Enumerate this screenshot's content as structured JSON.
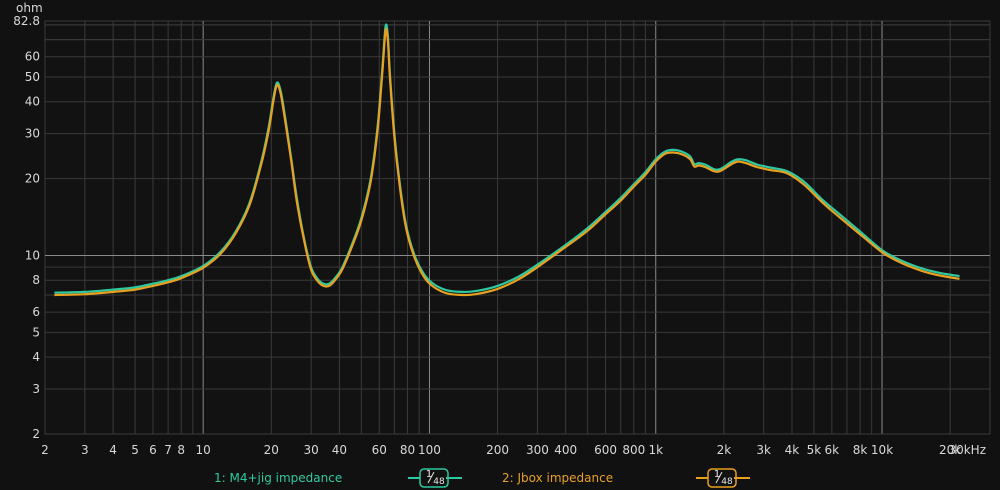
{
  "chart_data": {
    "type": "line",
    "ylabel": "ohm",
    "x_scale": "log",
    "y_scale": "log",
    "xlim": [
      2,
      30000
    ],
    "ylim": [
      2,
      82.8
    ],
    "x_ticks": [
      {
        "v": 2,
        "label": "2"
      },
      {
        "v": 3,
        "label": "3"
      },
      {
        "v": 4,
        "label": "4"
      },
      {
        "v": 5,
        "label": "5"
      },
      {
        "v": 6,
        "label": "6"
      },
      {
        "v": 7,
        "label": "7"
      },
      {
        "v": 8,
        "label": "8"
      },
      {
        "v": 10,
        "label": "10"
      },
      {
        "v": 20,
        "label": "20"
      },
      {
        "v": 30,
        "label": "30"
      },
      {
        "v": 40,
        "label": "40"
      },
      {
        "v": 60,
        "label": "60"
      },
      {
        "v": 80,
        "label": "80"
      },
      {
        "v": 100,
        "label": "100"
      },
      {
        "v": 200,
        "label": "200"
      },
      {
        "v": 300,
        "label": "300"
      },
      {
        "v": 400,
        "label": "400"
      },
      {
        "v": 600,
        "label": "600"
      },
      {
        "v": 800,
        "label": "800"
      },
      {
        "v": 1000,
        "label": "1k"
      },
      {
        "v": 2000,
        "label": "2k"
      },
      {
        "v": 3000,
        "label": "3k"
      },
      {
        "v": 4000,
        "label": "4k"
      },
      {
        "v": 5000,
        "label": "5k"
      },
      {
        "v": 6000,
        "label": "6k"
      },
      {
        "v": 8000,
        "label": "8k"
      },
      {
        "v": 10000,
        "label": "10k"
      },
      {
        "v": 20000,
        "label": "20k"
      },
      {
        "v": 30000,
        "label": "30kHz"
      }
    ],
    "y_ticks": [
      {
        "v": 2,
        "label": "2"
      },
      {
        "v": 3,
        "label": "3"
      },
      {
        "v": 4,
        "label": "4"
      },
      {
        "v": 5,
        "label": "5"
      },
      {
        "v": 6,
        "label": "6"
      },
      {
        "v": 8,
        "label": "8"
      },
      {
        "v": 10,
        "label": "10"
      },
      {
        "v": 20,
        "label": "20"
      },
      {
        "v": 30,
        "label": "30"
      },
      {
        "v": 40,
        "label": "40"
      },
      {
        "v": 50,
        "label": "50"
      },
      {
        "v": 60,
        "label": "60"
      },
      {
        "v": 82.8,
        "label": "82.8"
      }
    ],
    "grid": true,
    "legend_position": "bottom",
    "series": [
      {
        "name": "1: M4+jig impedance",
        "color": "#2ec9a0",
        "smoothing": "1/48",
        "points": [
          [
            2.2,
            7.15
          ],
          [
            3,
            7.2
          ],
          [
            4,
            7.35
          ],
          [
            5,
            7.5
          ],
          [
            6,
            7.75
          ],
          [
            7,
            8.0
          ],
          [
            8,
            8.3
          ],
          [
            10,
            9.1
          ],
          [
            12,
            10.4
          ],
          [
            14,
            12.5
          ],
          [
            16,
            16.0
          ],
          [
            18,
            23.0
          ],
          [
            19.5,
            32.0
          ],
          [
            20.5,
            42.0
          ],
          [
            21.2,
            47.5
          ],
          [
            22,
            44.0
          ],
          [
            23,
            35.0
          ],
          [
            24.5,
            24.0
          ],
          [
            26,
            16.5
          ],
          [
            28,
            11.5
          ],
          [
            30,
            9.0
          ],
          [
            32,
            8.1
          ],
          [
            34,
            7.75
          ],
          [
            36,
            7.75
          ],
          [
            38,
            8.1
          ],
          [
            41,
            8.9
          ],
          [
            45,
            10.8
          ],
          [
            50,
            14.0
          ],
          [
            55,
            20.0
          ],
          [
            59,
            32.0
          ],
          [
            62,
            55.0
          ],
          [
            64,
            79.0
          ],
          [
            65.5,
            72.0
          ],
          [
            67,
            50.0
          ],
          [
            70,
            30.0
          ],
          [
            74,
            19.0
          ],
          [
            79,
            13.0
          ],
          [
            86,
            10.0
          ],
          [
            95,
            8.4
          ],
          [
            105,
            7.7
          ],
          [
            120,
            7.3
          ],
          [
            140,
            7.2
          ],
          [
            160,
            7.25
          ],
          [
            200,
            7.6
          ],
          [
            250,
            8.3
          ],
          [
            300,
            9.2
          ],
          [
            400,
            11.0
          ],
          [
            500,
            12.8
          ],
          [
            600,
            14.8
          ],
          [
            700,
            16.8
          ],
          [
            800,
            19.0
          ],
          [
            900,
            21.2
          ],
          [
            1000,
            23.8
          ],
          [
            1100,
            25.5
          ],
          [
            1200,
            25.9
          ],
          [
            1320,
            25.4
          ],
          [
            1420,
            24.4
          ],
          [
            1480,
            22.8
          ],
          [
            1550,
            23.0
          ],
          [
            1650,
            22.7
          ],
          [
            1800,
            21.8
          ],
          [
            1900,
            21.7
          ],
          [
            2000,
            22.2
          ],
          [
            2150,
            23.2
          ],
          [
            2300,
            23.8
          ],
          [
            2500,
            23.6
          ],
          [
            2800,
            22.7
          ],
          [
            3200,
            22.1
          ],
          [
            3800,
            21.4
          ],
          [
            4500,
            19.5
          ],
          [
            5500,
            16.4
          ],
          [
            6500,
            14.5
          ],
          [
            8000,
            12.4
          ],
          [
            10000,
            10.5
          ],
          [
            12000,
            9.6
          ],
          [
            15000,
            8.9
          ],
          [
            18000,
            8.55
          ],
          [
            22000,
            8.3
          ]
        ]
      },
      {
        "name": "2: Jbox impedance",
        "color": "#e8a020",
        "smoothing": "1/48",
        "points": [
          [
            2.2,
            7.0
          ],
          [
            3,
            7.05
          ],
          [
            4,
            7.2
          ],
          [
            5,
            7.35
          ],
          [
            6,
            7.6
          ],
          [
            7,
            7.85
          ],
          [
            8,
            8.15
          ],
          [
            10,
            8.95
          ],
          [
            12,
            10.2
          ],
          [
            14,
            12.3
          ],
          [
            16,
            15.7
          ],
          [
            18,
            22.5
          ],
          [
            19.5,
            31.0
          ],
          [
            20.5,
            41.0
          ],
          [
            21.2,
            46.5
          ],
          [
            22,
            43.0
          ],
          [
            23,
            34.0
          ],
          [
            24.5,
            23.5
          ],
          [
            26,
            16.0
          ],
          [
            28,
            11.3
          ],
          [
            30,
            8.8
          ],
          [
            32,
            7.95
          ],
          [
            34,
            7.6
          ],
          [
            36,
            7.6
          ],
          [
            38,
            7.95
          ],
          [
            41,
            8.75
          ],
          [
            45,
            10.6
          ],
          [
            50,
            13.7
          ],
          [
            55,
            19.5
          ],
          [
            59,
            31.0
          ],
          [
            62,
            53.0
          ],
          [
            64,
            76.0
          ],
          [
            65.5,
            69.0
          ],
          [
            67,
            48.5
          ],
          [
            70,
            29.0
          ],
          [
            74,
            18.5
          ],
          [
            79,
            12.7
          ],
          [
            86,
            9.8
          ],
          [
            95,
            8.2
          ],
          [
            105,
            7.5
          ],
          [
            120,
            7.1
          ],
          [
            140,
            7.0
          ],
          [
            160,
            7.05
          ],
          [
            200,
            7.4
          ],
          [
            250,
            8.1
          ],
          [
            300,
            9.0
          ],
          [
            400,
            10.8
          ],
          [
            500,
            12.5
          ],
          [
            600,
            14.5
          ],
          [
            700,
            16.4
          ],
          [
            800,
            18.6
          ],
          [
            900,
            20.7
          ],
          [
            1000,
            23.3
          ],
          [
            1100,
            25.0
          ],
          [
            1200,
            25.3
          ],
          [
            1320,
            24.8
          ],
          [
            1420,
            23.8
          ],
          [
            1480,
            22.3
          ],
          [
            1550,
            22.5
          ],
          [
            1650,
            22.2
          ],
          [
            1800,
            21.4
          ],
          [
            1900,
            21.3
          ],
          [
            2000,
            21.8
          ],
          [
            2150,
            22.7
          ],
          [
            2300,
            23.3
          ],
          [
            2500,
            23.0
          ],
          [
            2800,
            22.2
          ],
          [
            3200,
            21.6
          ],
          [
            3800,
            21.0
          ],
          [
            4500,
            19.0
          ],
          [
            5500,
            16.0
          ],
          [
            6500,
            14.1
          ],
          [
            8000,
            12.1
          ],
          [
            10000,
            10.3
          ],
          [
            12000,
            9.4
          ],
          [
            15000,
            8.7
          ],
          [
            18000,
            8.35
          ],
          [
            22000,
            8.1
          ]
        ]
      }
    ]
  }
}
